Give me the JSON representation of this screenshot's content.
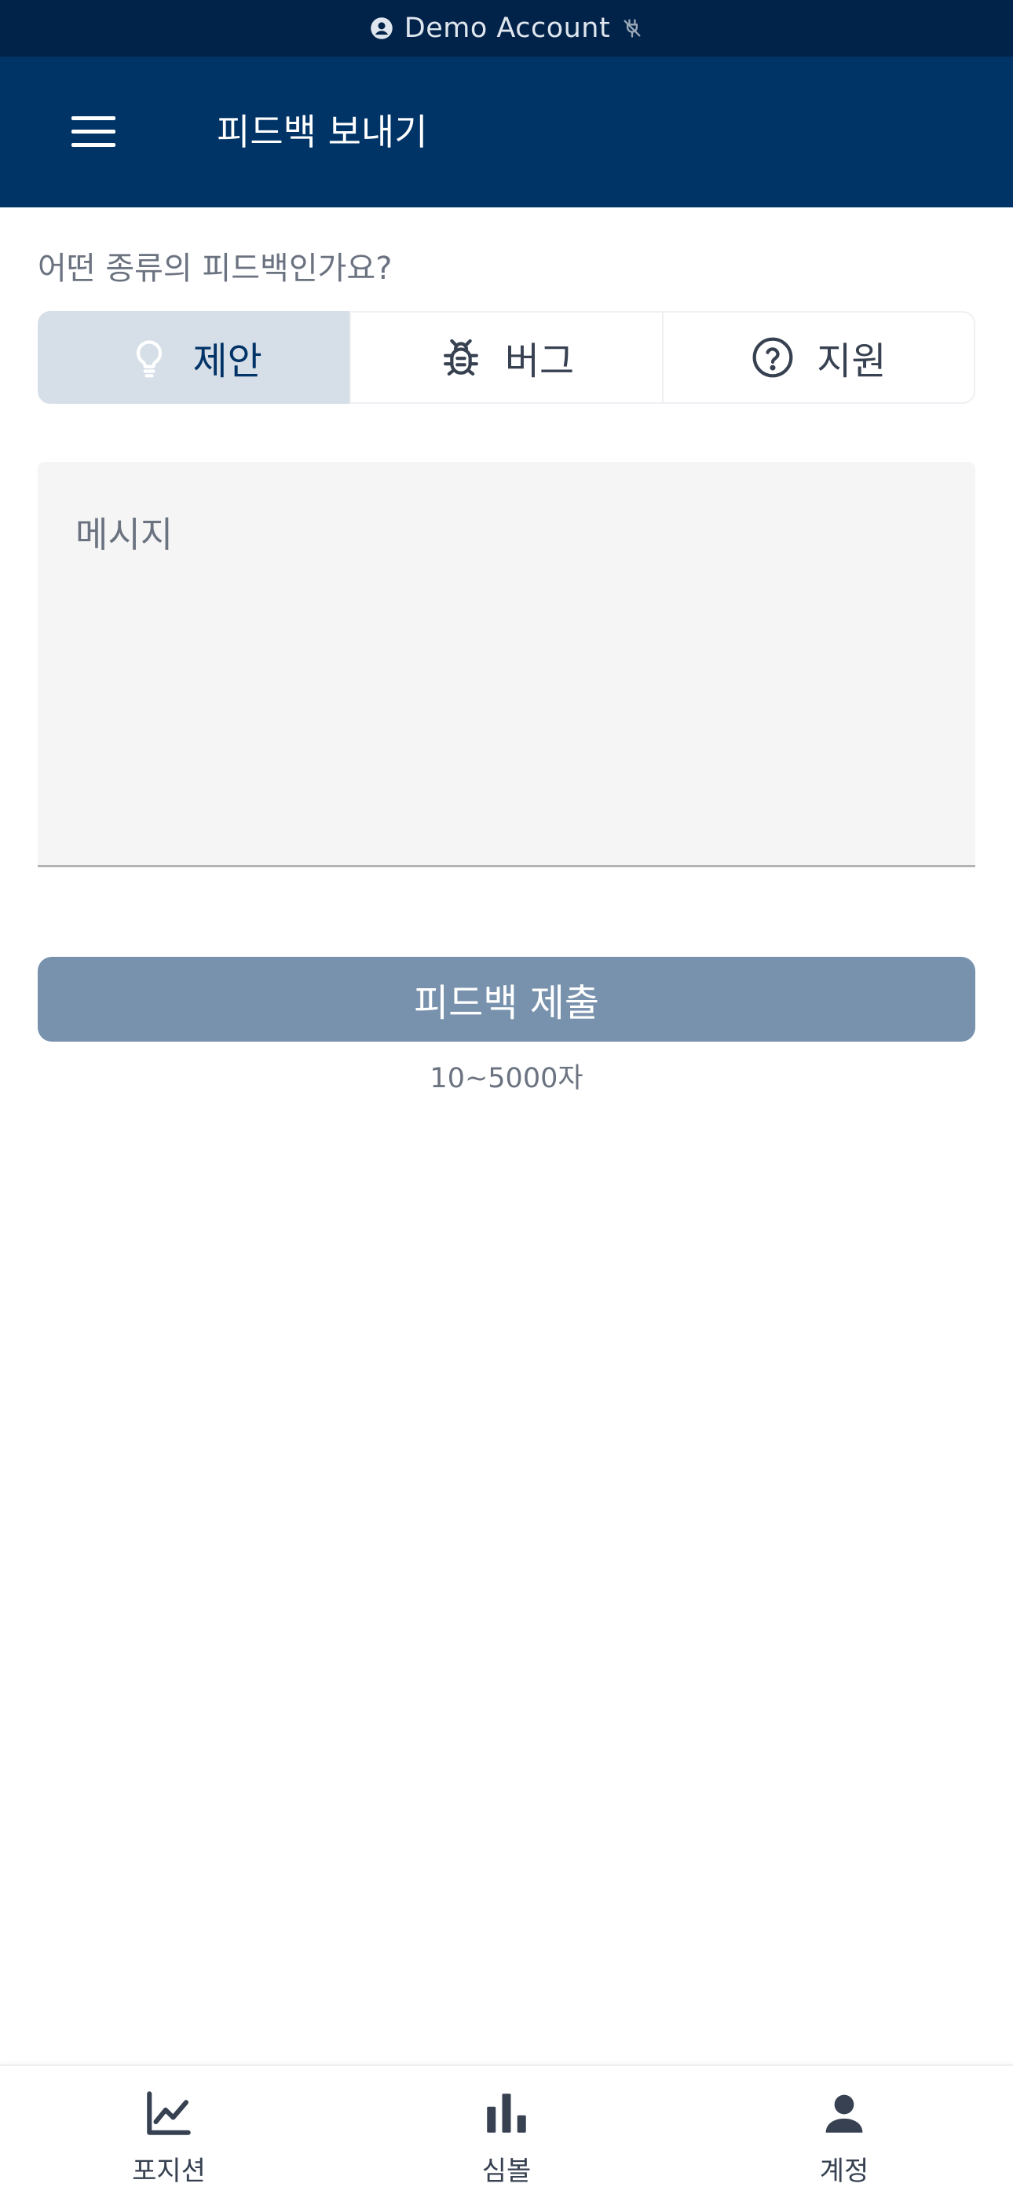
{
  "status_bar": {
    "account_label": "Demo Account",
    "account_icon": "account-circle-icon",
    "connection_icon": "plug-disconnected-icon"
  },
  "header": {
    "menu_icon": "hamburger-menu-icon",
    "title": "피드백 보내기",
    "background": "#003366"
  },
  "form": {
    "question": "어떤 종류의 피드백인가요?",
    "types": [
      {
        "label": "제안",
        "icon": "lightbulb-icon",
        "selected": true
      },
      {
        "label": "버그",
        "icon": "bug-icon",
        "selected": false
      },
      {
        "label": "지원",
        "icon": "help-circle-icon",
        "selected": false
      }
    ],
    "message_placeholder": "메시지",
    "message_value": "",
    "submit_label": "피드백 제출",
    "submit_color": "#7892ad",
    "char_hint": "10~5000자"
  },
  "bottom_nav": {
    "items": [
      {
        "label": "포지션",
        "icon": "line-chart-icon"
      },
      {
        "label": "심볼",
        "icon": "bar-chart-icon"
      },
      {
        "label": "계정",
        "icon": "person-icon"
      }
    ]
  }
}
